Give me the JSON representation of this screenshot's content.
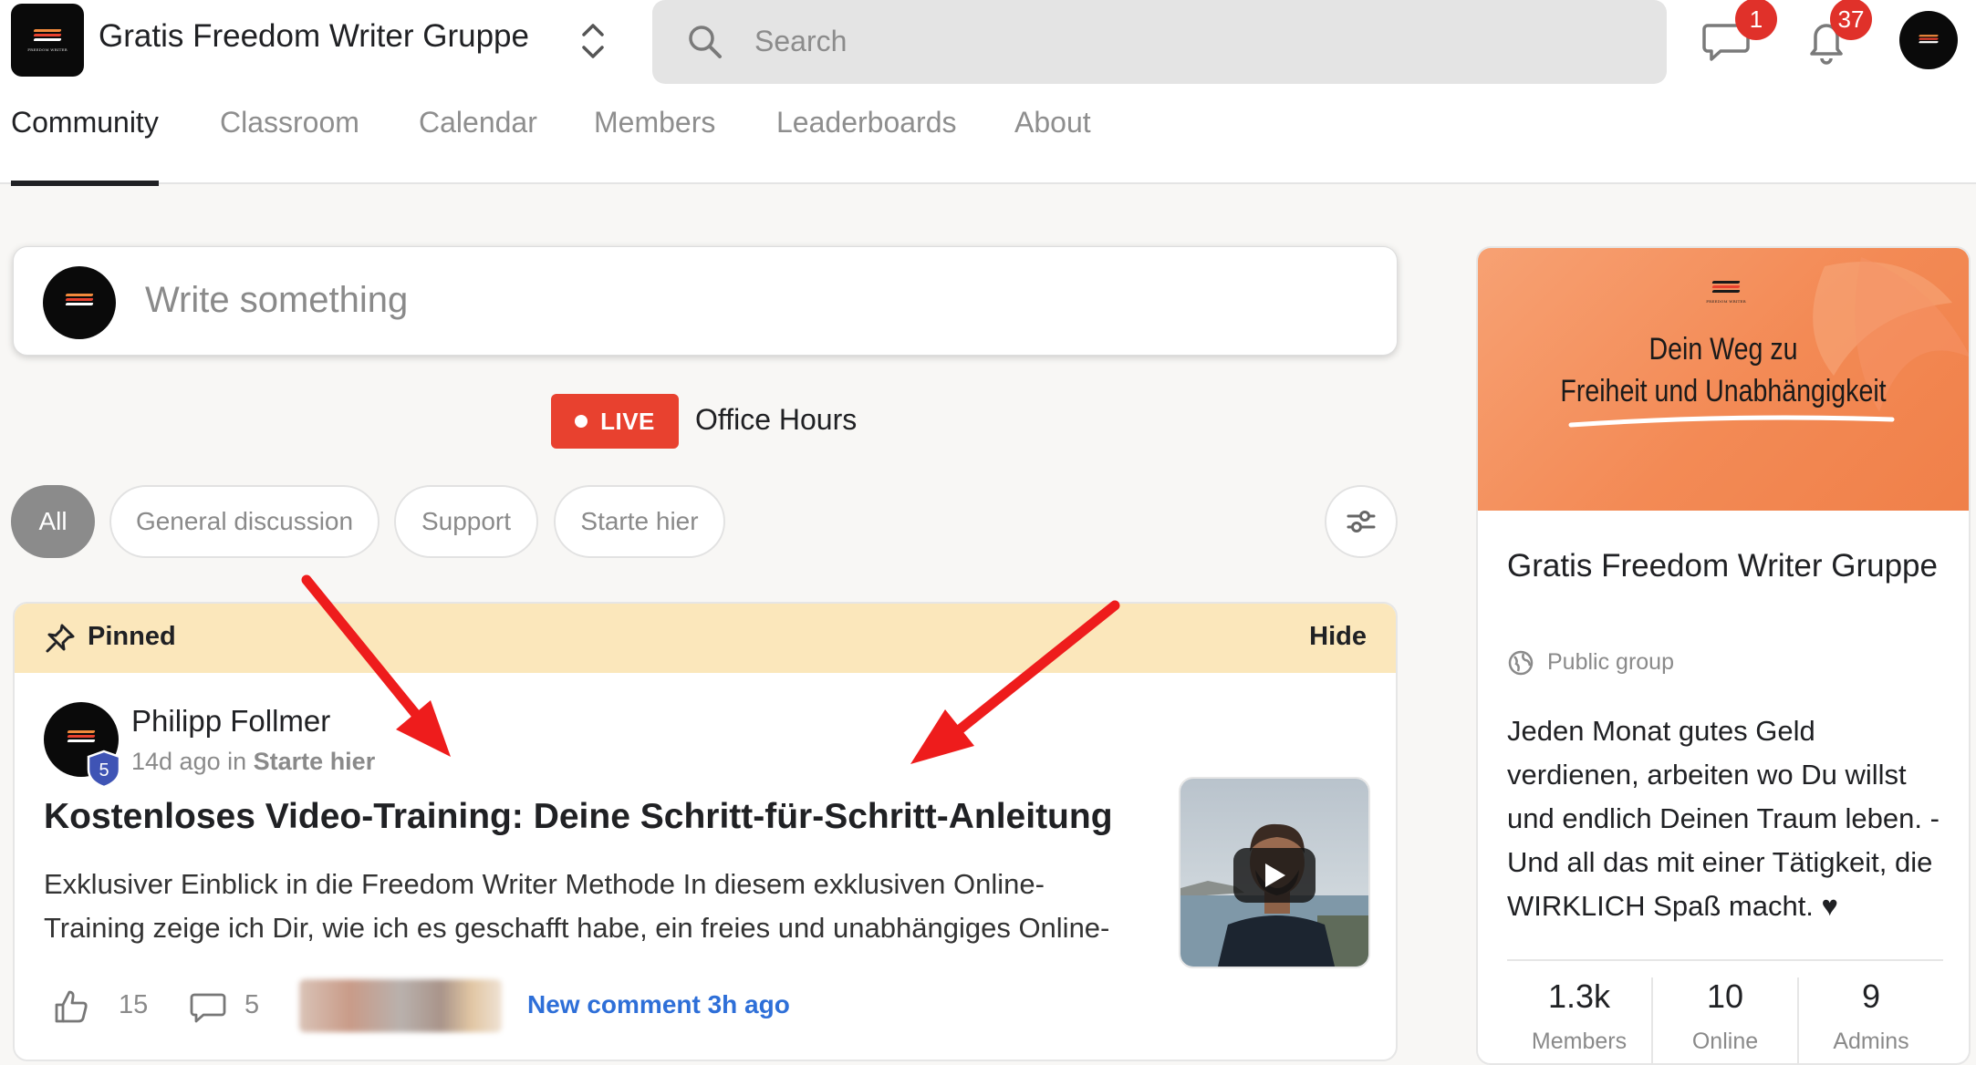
{
  "header": {
    "group_title": "Gratis Freedom Writer Gruppe",
    "logo_text": "FREEDOM WRITER",
    "search_placeholder": "Search",
    "chat_badge": "1",
    "notifications_badge": "37"
  },
  "tabs": [
    "Community",
    "Classroom",
    "Calendar",
    "Members",
    "Leaderboards",
    "About"
  ],
  "composer": {
    "placeholder": "Write something"
  },
  "live": {
    "badge": "LIVE",
    "title": "Office Hours"
  },
  "filters": [
    "All",
    "General discussion",
    "Support",
    "Starte hier"
  ],
  "post": {
    "pinned_label": "Pinned",
    "hide_label": "Hide",
    "author": "Philipp Follmer",
    "author_level": "5",
    "time": "14d ago",
    "in_word": "in",
    "category": "Starte hier",
    "title": "Kostenloses Video-Training: Deine Schritt-für-Schritt-Anleitung",
    "body_line1": "Exklusiver Einblick in die Freedom Writer Methode In diesem exklusiven Online-",
    "body_line2": "Training zeige ich Dir, wie ich es geschafft habe, ein freies und unabhängiges Online-",
    "likes": "15",
    "comments": "5",
    "new_comment": "New comment 3h ago"
  },
  "sidebar": {
    "cover_logo_text": "FREEDOM WRITER",
    "cover_line1": "Dein Weg zu",
    "cover_line2": "Freiheit und Unabhängigkeit",
    "title": "Gratis Freedom Writer Gruppe",
    "privacy": "Public group",
    "description": "Jeden Monat gutes Geld verdienen, arbeiten wo Du willst und endlich Deinen Traum leben. - Und all das mit einer Tätigkeit, die WIRKLICH Spaß macht. ♥",
    "stats": [
      {
        "value": "1.3k",
        "label": "Members"
      },
      {
        "value": "10",
        "label": "Online"
      },
      {
        "value": "9",
        "label": "Admins"
      }
    ]
  },
  "colors": {
    "accent_live": "#e8412f",
    "link_blue": "#2e6fd8",
    "pinned_bg": "#fbe7bb",
    "cover_orange": "#f38a55",
    "annotation_arrow": "#ee1c1c"
  }
}
